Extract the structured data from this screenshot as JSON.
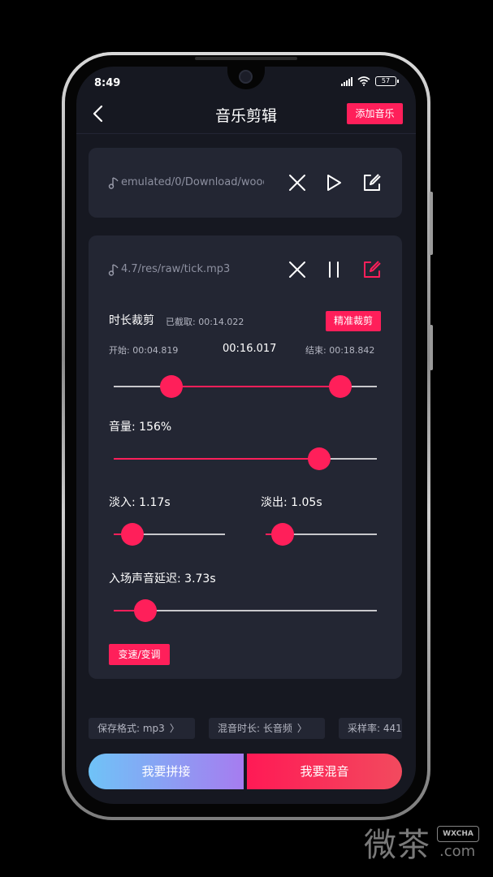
{
  "status": {
    "time": "8:49",
    "battery": "57"
  },
  "header": {
    "title": "音乐剪辑",
    "add_music_label": "添加音乐"
  },
  "track1": {
    "path": "emulated/0/Download/wood"
  },
  "track2": {
    "path": "4.7/res/raw/tick.mp3",
    "trim_label": "时长裁剪",
    "trimmed_label": "已截取: 00:14.022",
    "precise_trim_label": "精准裁剪",
    "start_label": "开始: 00:04.819",
    "current_time": "00:16.017",
    "end_label": "结束: 00:18.842",
    "trim_range": [
      0.22,
      0.86
    ],
    "volume_label": "音量: 156%",
    "volume_fraction": 0.78,
    "fade_in_label": "淡入: 1.17s",
    "fade_in_fraction": 0.17,
    "fade_out_label": "淡出: 1.05s",
    "fade_out_fraction": 0.15,
    "delay_label": "入场声音延迟: 3.73s",
    "delay_fraction": 0.12,
    "speed_pitch_label": "变速/变调"
  },
  "options": [
    {
      "label": "保存格式: mp3"
    },
    {
      "label": "混音时长: 长音频"
    },
    {
      "label": "采样率: 441"
    }
  ],
  "actions": {
    "concat_label": "我要拼接",
    "mix_label": "我要混音"
  },
  "watermark": {
    "text": "微茶",
    "badge": "WXCHA",
    "suffix": ".com"
  },
  "colors": {
    "accent": "#ff1f5a",
    "card": "#232633",
    "background": "#161821"
  }
}
